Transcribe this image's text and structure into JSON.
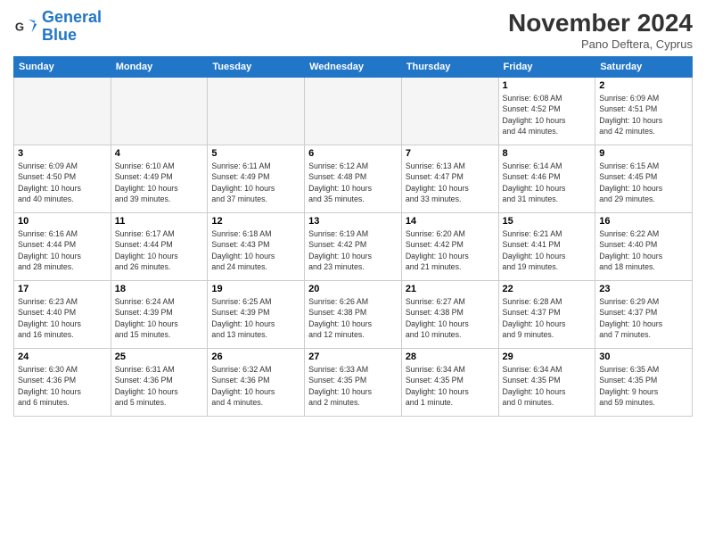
{
  "logo": {
    "line1": "General",
    "line2": "Blue"
  },
  "title": "November 2024",
  "subtitle": "Pano Deftera, Cyprus",
  "weekdays": [
    "Sunday",
    "Monday",
    "Tuesday",
    "Wednesday",
    "Thursday",
    "Friday",
    "Saturday"
  ],
  "weeks": [
    [
      {
        "day": "",
        "info": ""
      },
      {
        "day": "",
        "info": ""
      },
      {
        "day": "",
        "info": ""
      },
      {
        "day": "",
        "info": ""
      },
      {
        "day": "",
        "info": ""
      },
      {
        "day": "1",
        "info": "Sunrise: 6:08 AM\nSunset: 4:52 PM\nDaylight: 10 hours\nand 44 minutes."
      },
      {
        "day": "2",
        "info": "Sunrise: 6:09 AM\nSunset: 4:51 PM\nDaylight: 10 hours\nand 42 minutes."
      }
    ],
    [
      {
        "day": "3",
        "info": "Sunrise: 6:09 AM\nSunset: 4:50 PM\nDaylight: 10 hours\nand 40 minutes."
      },
      {
        "day": "4",
        "info": "Sunrise: 6:10 AM\nSunset: 4:49 PM\nDaylight: 10 hours\nand 39 minutes."
      },
      {
        "day": "5",
        "info": "Sunrise: 6:11 AM\nSunset: 4:49 PM\nDaylight: 10 hours\nand 37 minutes."
      },
      {
        "day": "6",
        "info": "Sunrise: 6:12 AM\nSunset: 4:48 PM\nDaylight: 10 hours\nand 35 minutes."
      },
      {
        "day": "7",
        "info": "Sunrise: 6:13 AM\nSunset: 4:47 PM\nDaylight: 10 hours\nand 33 minutes."
      },
      {
        "day": "8",
        "info": "Sunrise: 6:14 AM\nSunset: 4:46 PM\nDaylight: 10 hours\nand 31 minutes."
      },
      {
        "day": "9",
        "info": "Sunrise: 6:15 AM\nSunset: 4:45 PM\nDaylight: 10 hours\nand 29 minutes."
      }
    ],
    [
      {
        "day": "10",
        "info": "Sunrise: 6:16 AM\nSunset: 4:44 PM\nDaylight: 10 hours\nand 28 minutes."
      },
      {
        "day": "11",
        "info": "Sunrise: 6:17 AM\nSunset: 4:44 PM\nDaylight: 10 hours\nand 26 minutes."
      },
      {
        "day": "12",
        "info": "Sunrise: 6:18 AM\nSunset: 4:43 PM\nDaylight: 10 hours\nand 24 minutes."
      },
      {
        "day": "13",
        "info": "Sunrise: 6:19 AM\nSunset: 4:42 PM\nDaylight: 10 hours\nand 23 minutes."
      },
      {
        "day": "14",
        "info": "Sunrise: 6:20 AM\nSunset: 4:42 PM\nDaylight: 10 hours\nand 21 minutes."
      },
      {
        "day": "15",
        "info": "Sunrise: 6:21 AM\nSunset: 4:41 PM\nDaylight: 10 hours\nand 19 minutes."
      },
      {
        "day": "16",
        "info": "Sunrise: 6:22 AM\nSunset: 4:40 PM\nDaylight: 10 hours\nand 18 minutes."
      }
    ],
    [
      {
        "day": "17",
        "info": "Sunrise: 6:23 AM\nSunset: 4:40 PM\nDaylight: 10 hours\nand 16 minutes."
      },
      {
        "day": "18",
        "info": "Sunrise: 6:24 AM\nSunset: 4:39 PM\nDaylight: 10 hours\nand 15 minutes."
      },
      {
        "day": "19",
        "info": "Sunrise: 6:25 AM\nSunset: 4:39 PM\nDaylight: 10 hours\nand 13 minutes."
      },
      {
        "day": "20",
        "info": "Sunrise: 6:26 AM\nSunset: 4:38 PM\nDaylight: 10 hours\nand 12 minutes."
      },
      {
        "day": "21",
        "info": "Sunrise: 6:27 AM\nSunset: 4:38 PM\nDaylight: 10 hours\nand 10 minutes."
      },
      {
        "day": "22",
        "info": "Sunrise: 6:28 AM\nSunset: 4:37 PM\nDaylight: 10 hours\nand 9 minutes."
      },
      {
        "day": "23",
        "info": "Sunrise: 6:29 AM\nSunset: 4:37 PM\nDaylight: 10 hours\nand 7 minutes."
      }
    ],
    [
      {
        "day": "24",
        "info": "Sunrise: 6:30 AM\nSunset: 4:36 PM\nDaylight: 10 hours\nand 6 minutes."
      },
      {
        "day": "25",
        "info": "Sunrise: 6:31 AM\nSunset: 4:36 PM\nDaylight: 10 hours\nand 5 minutes."
      },
      {
        "day": "26",
        "info": "Sunrise: 6:32 AM\nSunset: 4:36 PM\nDaylight: 10 hours\nand 4 minutes."
      },
      {
        "day": "27",
        "info": "Sunrise: 6:33 AM\nSunset: 4:35 PM\nDaylight: 10 hours\nand 2 minutes."
      },
      {
        "day": "28",
        "info": "Sunrise: 6:34 AM\nSunset: 4:35 PM\nDaylight: 10 hours\nand 1 minute."
      },
      {
        "day": "29",
        "info": "Sunrise: 6:34 AM\nSunset: 4:35 PM\nDaylight: 10 hours\nand 0 minutes."
      },
      {
        "day": "30",
        "info": "Sunrise: 6:35 AM\nSunset: 4:35 PM\nDaylight: 9 hours\nand 59 minutes."
      }
    ]
  ]
}
